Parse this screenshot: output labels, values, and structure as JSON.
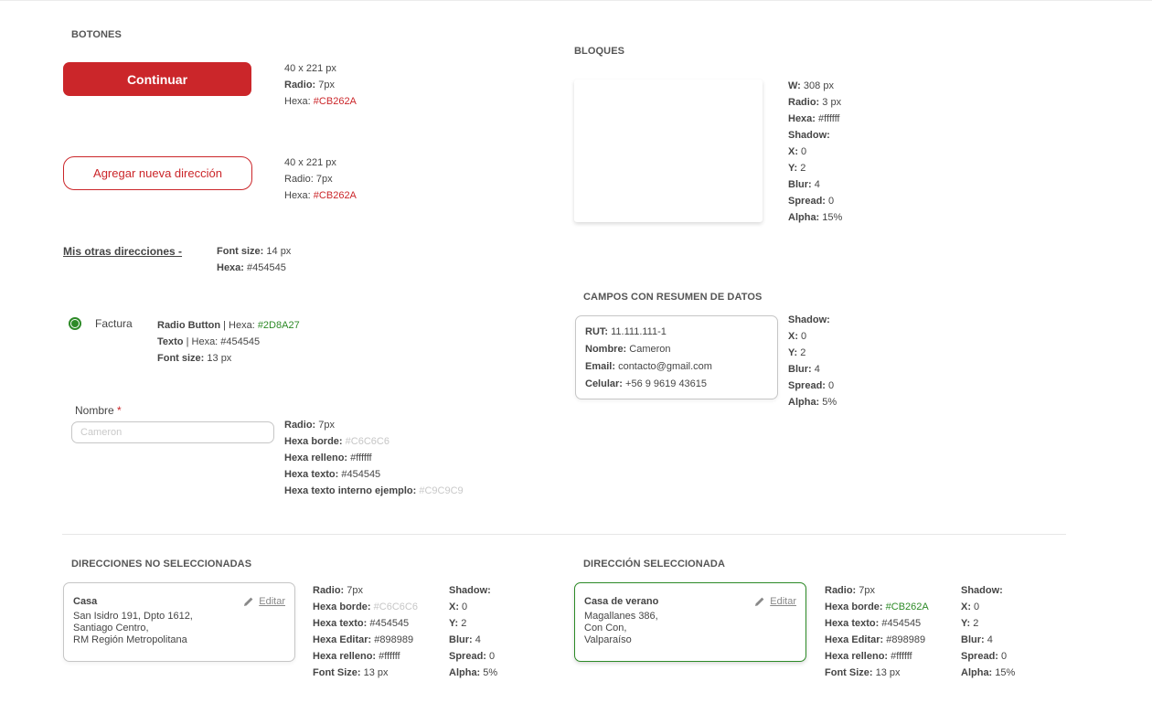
{
  "buttons_section": {
    "title": "BOTONES",
    "primary_label": "Continuar",
    "primary_spec": {
      "size": "40 x 221 px",
      "radius_label": "Radio:",
      "radius": " 7px",
      "hex_label": "Hexa:",
      "hex": " #CB262A"
    },
    "outline_label": "Agregar nueva dirección",
    "outline_spec": {
      "size": "40 x 221 px",
      "radius_label": "Radio:",
      "radius": " 7px",
      "hex_label": "Hexa:",
      "hex": " #CB262A"
    }
  },
  "other_addresses": {
    "link": "Mis otras direcciones -",
    "font_label": "Font size:",
    "font": " 14 px",
    "hex_label": "Hexa:",
    "hex": " #454545"
  },
  "radio": {
    "label": "Factura",
    "line1_label": "Radio Button",
    "line1_mid": " | Hexa: ",
    "line1_hex": "#2D8A27",
    "line2_label": "Texto",
    "line2_rest": " | Hexa: #454545",
    "line3_label": "Font size:",
    "line3_rest": " 13 px"
  },
  "input_field": {
    "label": "Nombre",
    "required": "*",
    "placeholder": "Cameron",
    "spec": {
      "radius_label": "Radio:",
      "radius": " 7px",
      "border_label": "Hexa borde:",
      "border": " #C6C6C6",
      "fill_label": "Hexa relleno:",
      "fill": " #ffffff",
      "text_label": "Hexa texto:",
      "text": " #454545",
      "inner_label": "Hexa texto interno ejemplo:",
      "inner": " #C9C9C9"
    }
  },
  "blocks": {
    "title": "BLOQUES",
    "spec": [
      {
        "label": "W:",
        "value": " 308 px"
      },
      {
        "label": "Radio:",
        "value": " 3 px"
      },
      {
        "label": "Hexa:",
        "value": " #ffffff"
      },
      {
        "label": "Shadow:",
        "value": ""
      },
      {
        "label": "X:",
        "value": " 0"
      },
      {
        "label": "Y:",
        "value": " 2"
      },
      {
        "label": "Blur:",
        "value": " 4"
      },
      {
        "label": "Spread:",
        "value": " 0"
      },
      {
        "label": "Alpha:",
        "value": " 15%"
      }
    ]
  },
  "summary": {
    "title": "CAMPOS CON RESUMEN DE DATOS",
    "rows": [
      {
        "label": "RUT:",
        "value": " 11.111.111-1"
      },
      {
        "label": "Nombre:",
        "value": " Cameron"
      },
      {
        "label": "Email:",
        "value": " contacto@gmail.com"
      },
      {
        "label": "Celular:",
        "value": " +56 9 9619 43615"
      }
    ],
    "spec": [
      {
        "label": "Shadow:",
        "value": ""
      },
      {
        "label": "X:",
        "value": " 0"
      },
      {
        "label": "Y:",
        "value": " 2"
      },
      {
        "label": "Blur:",
        "value": " 4"
      },
      {
        "label": "Spread:",
        "value": " 0"
      },
      {
        "label": "Alpha:",
        "value": " 5%"
      }
    ]
  },
  "unselected": {
    "title": "DIRECCIONES NO SELECCIONADAS",
    "card": {
      "name": "Casa",
      "edit": "Editar",
      "lines": [
        "San Isidro 191, Dpto 1612,",
        "Santiago Centro,",
        "RM Región Metropolitana"
      ]
    },
    "spec_left": [
      {
        "label": "Radio:",
        "value": " 7px"
      },
      {
        "label": "Hexa borde:",
        "value": " #C6C6C6"
      },
      {
        "label": "Hexa texto:",
        "value": " #454545"
      },
      {
        "label": "Hexa Editar:",
        "value": " #898989"
      },
      {
        "label": "Hexa relleno:",
        "value": " #ffffff"
      },
      {
        "label": "Font Size:",
        "value": " 13 px"
      }
    ],
    "spec_right": [
      {
        "label": "Shadow:",
        "value": ""
      },
      {
        "label": "X:",
        "value": " 0"
      },
      {
        "label": "Y:",
        "value": " 2"
      },
      {
        "label": "Blur:",
        "value": " 4"
      },
      {
        "label": "Spread:",
        "value": " 0"
      },
      {
        "label": "Alpha:",
        "value": " 5%"
      }
    ]
  },
  "selected": {
    "title": "DIRECCIÓN SELECCIONADA",
    "card": {
      "name": "Casa de verano",
      "edit": "Editar",
      "lines": [
        "Magallanes 386,",
        "Con Con,",
        "Valparaíso"
      ]
    },
    "spec_left": [
      {
        "label": "Radio:",
        "value": " 7px"
      },
      {
        "label": "Hexa borde:",
        "value": " #CB262A"
      },
      {
        "label": "Hexa texto:",
        "value": " #454545"
      },
      {
        "label": "Hexa Editar:",
        "value": " #898989"
      },
      {
        "label": "Hexa relleno:",
        "value": " #ffffff"
      },
      {
        "label": "Font Size:",
        "value": " 13 px"
      }
    ],
    "spec_right": [
      {
        "label": "Shadow:",
        "value": ""
      },
      {
        "label": "X:",
        "value": " 0"
      },
      {
        "label": "Y:",
        "value": " 2"
      },
      {
        "label": "Blur:",
        "value": " 4"
      },
      {
        "label": "Spread:",
        "value": " 0"
      },
      {
        "label": "Alpha:",
        "value": " 15%"
      }
    ]
  },
  "colors": {
    "brand_red": "#CB262A",
    "green": "#2D8A27",
    "text": "#454545",
    "border": "#C6C6C6",
    "placeholder": "#C9C9C9",
    "edit": "#898989"
  },
  "icons": {
    "edit": "pencil-icon",
    "radio": "radio-selected-icon"
  }
}
